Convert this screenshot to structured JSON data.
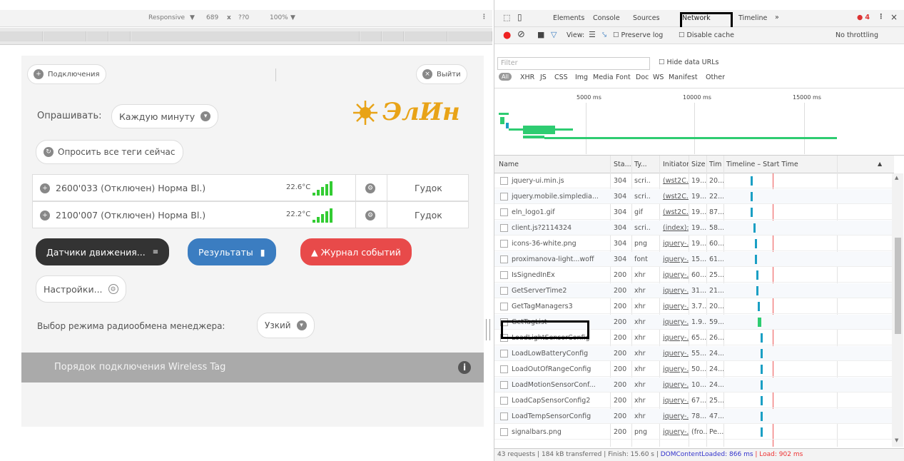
{
  "colors": {
    "accent": "#3b7dc1",
    "danger": "#e84a4a",
    "dark": "#333333",
    "logo": "#e8a317",
    "net_green": "#2ecc71",
    "net_blue": "#1a9fc4"
  },
  "device_bar": {
    "mode": "Responsive",
    "width": "689",
    "x": "x",
    "height": "??0",
    "zoom": "100%"
  },
  "app": {
    "connection_label": "Подключения",
    "logout_label": "Выйти",
    "poll_label": "Опрашивать:",
    "poll_value": "Каждую минуту",
    "poll_now_label": "Опросить все теги сейчас",
    "logo_text": "ЭлИн",
    "tags": [
      {
        "name": "2600'033 (Отключен) Норма Bl.)",
        "temp": "22.6°C",
        "signal": "5",
        "action": "Гудок"
      },
      {
        "name": "2100'007 (Отключен) Норма Bl.)",
        "temp": "22.2°C",
        "signal": "5",
        "action": "Гудок"
      }
    ],
    "motion_button": "Датчики движения...",
    "results_button": "Результаты",
    "journal_button": "Журнал событий",
    "settings_button": "Настройки...",
    "radio_label": "Выбор режима радиообмена менеджера:",
    "radio_value": "Узкий",
    "info_bar": "Порядок подключения Wireless Tag"
  },
  "devtools": {
    "tabs": [
      "Elements",
      "Console",
      "Sources",
      "Network",
      "Timeline"
    ],
    "active_tab": "Network",
    "more": "»",
    "errors": "4",
    "view_label": "View:",
    "preserve_log": "Preserve log",
    "disable_cache": "Disable cache",
    "throttling": "No throttling",
    "filter_placeholder": "Filter",
    "hide_data_urls": "Hide data URLs",
    "types": [
      "All",
      "XHR",
      "JS",
      "CSS",
      "Img",
      "Media",
      "Font",
      "Doc",
      "WS",
      "Manifest",
      "Other"
    ],
    "timeline_ticks": [
      "5000 ms",
      "10000 ms",
      "15000 ms"
    ],
    "columns": [
      "Name",
      "Sta...",
      "Ty...",
      "Initiator",
      "Size",
      "Tim",
      "Timeline – Start Time"
    ],
    "requests": [
      {
        "name": "jquery-ui.min.js",
        "status": "304",
        "type": "scri..",
        "initiator": "(wst2C...",
        "size": "19...",
        "time": "20...",
        "bar": 0.12
      },
      {
        "name": "jquery.mobile.simpledia...",
        "status": "304",
        "type": "scri..",
        "initiator": "(wst2C...",
        "size": "19...",
        "time": "22...",
        "bar": 0.12
      },
      {
        "name": "eln_logo1.gif",
        "status": "304",
        "type": "gif",
        "initiator": "(wst2C...",
        "size": "19...",
        "time": "87...",
        "bar": 0.12
      },
      {
        "name": "client.js?2114324",
        "status": "304",
        "type": "scri..",
        "initiator": "(index):...",
        "size": "19...",
        "time": "58...",
        "bar": 0.14
      },
      {
        "name": "icons-36-white.png",
        "status": "304",
        "type": "png",
        "initiator": "jquery-...",
        "size": "19...",
        "time": "60...",
        "bar": 0.15
      },
      {
        "name": "proximanova-light...woff",
        "status": "304",
        "type": "font",
        "initiator": "jquery-...",
        "size": "15...",
        "time": "61...",
        "bar": 0.15
      },
      {
        "name": "IsSignedInEx",
        "status": "200",
        "type": "xhr",
        "initiator": "jquery-...",
        "size": "60...",
        "time": "25...",
        "bar": 0.16
      },
      {
        "name": "GetServerTime2",
        "status": "200",
        "type": "xhr",
        "initiator": "jquery-...",
        "size": "31...",
        "time": "21...",
        "bar": 0.16
      },
      {
        "name": "GetTagManagers3",
        "status": "200",
        "type": "xhr",
        "initiator": "jquery-...",
        "size": "3.7...",
        "time": "20...",
        "bar": 0.17
      },
      {
        "name": "GetTagList",
        "status": "200",
        "type": "xhr",
        "initiator": "jquery-...",
        "size": "1.9...",
        "time": "59...",
        "bar": 0.17
      },
      {
        "name": "LoadLightSensorConfig",
        "status": "200",
        "type": "xhr",
        "initiator": "jquery-...",
        "size": "65...",
        "time": "26...",
        "bar": 0.19
      },
      {
        "name": "LoadLowBatteryConfig",
        "status": "200",
        "type": "xhr",
        "initiator": "jquery-...",
        "size": "55...",
        "time": "24...",
        "bar": 0.19
      },
      {
        "name": "LoadOutOfRangeConfig",
        "status": "200",
        "type": "xhr",
        "initiator": "jquery-...",
        "size": "50...",
        "time": "24...",
        "bar": 0.19
      },
      {
        "name": "LoadMotionSensorConf...",
        "status": "200",
        "type": "xhr",
        "initiator": "jquery-...",
        "size": "10...",
        "time": "24...",
        "bar": 0.19
      },
      {
        "name": "LoadCapSensorConfig2",
        "status": "200",
        "type": "xhr",
        "initiator": "jquery-...",
        "size": "67...",
        "time": "25...",
        "bar": 0.19
      },
      {
        "name": "LoadTempSensorConfig",
        "status": "200",
        "type": "xhr",
        "initiator": "jquery-...",
        "size": "78...",
        "time": "47...",
        "bar": 0.19
      },
      {
        "name": "signalbars.png",
        "status": "200",
        "type": "png",
        "initiator": "jquery-...",
        "size": "(fro...",
        "time": "Pe...",
        "bar": 0.19
      }
    ],
    "status_bar": "43 requests | 184 kB transferred | Finish: 15.60 s | ",
    "dcl": "DOMContentLoaded: 866 ms",
    "load": " | Load: 902 ms"
  }
}
